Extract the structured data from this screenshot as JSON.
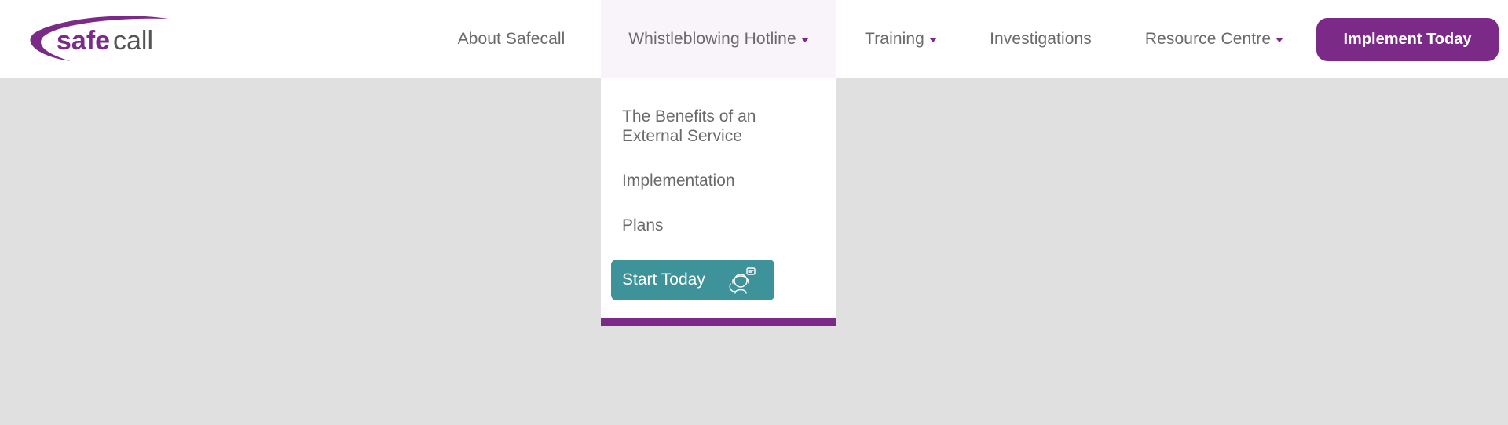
{
  "brand": {
    "logo_text_bold": "safe",
    "logo_text_light": "call",
    "accent_color": "#7b2a88",
    "teal_color": "#3e939b"
  },
  "nav": {
    "items": [
      {
        "label": "About Safecall",
        "has_dropdown": false
      },
      {
        "label": "Whistleblowing Hotline",
        "has_dropdown": true,
        "expanded": true
      },
      {
        "label": "Training",
        "has_dropdown": true
      },
      {
        "label": "Investigations",
        "has_dropdown": false
      },
      {
        "label": "Resource Centre",
        "has_dropdown": true
      }
    ],
    "cta_label": "Implement Today"
  },
  "dropdown": {
    "items": [
      {
        "label": "The Benefits of an External Service"
      },
      {
        "label": "Implementation"
      },
      {
        "label": "Plans"
      }
    ],
    "start_button_label": "Start Today",
    "start_button_icon": "support-agent-icon"
  }
}
